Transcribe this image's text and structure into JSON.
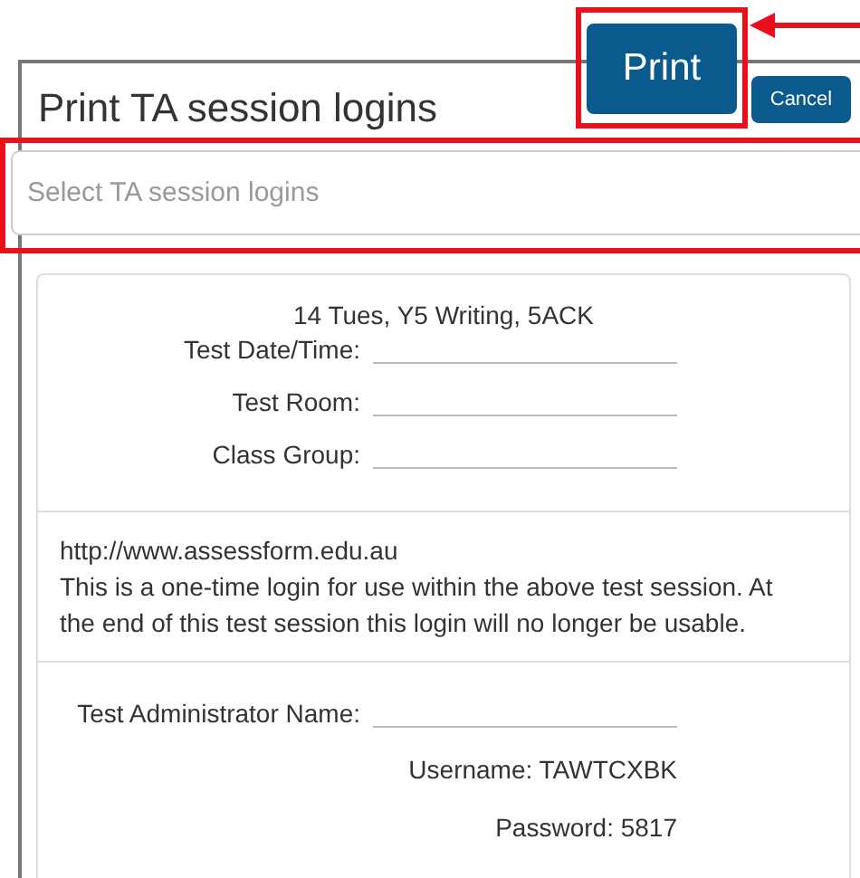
{
  "dialog": {
    "title": "Print TA session logins",
    "buttons": [
      {
        "label": "Print",
        "kind": "large",
        "highlighted": true,
        "arrow": true
      },
      {
        "label": "Cancel",
        "kind": "small",
        "highlighted": false,
        "arrow": false
      }
    ],
    "select": {
      "placeholder": "Select TA session logins",
      "highlighted": true
    },
    "login_card": {
      "heading": "14 Tues, Y5 Writing, 5ACK",
      "fields": [
        {
          "label": "Test Date/Time:"
        },
        {
          "label": "Test Room:"
        },
        {
          "label": "Class Group:"
        }
      ],
      "url": "http://www.assessform.edu.au",
      "note": "This is a one-time login for use within the above test session. At the end of this test session this login will no longer be usable.",
      "admin_field": {
        "label": "Test Administrator Name:"
      },
      "username": "Username: TAWTCXBK",
      "password": "Password: 5817"
    }
  }
}
